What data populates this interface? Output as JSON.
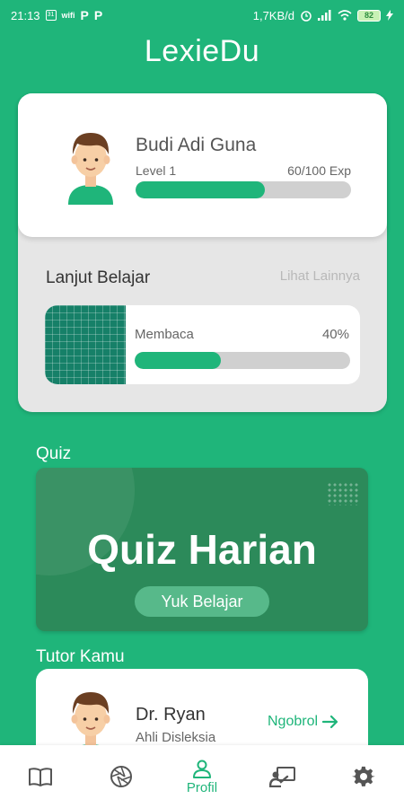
{
  "status_bar": {
    "time": "21:13",
    "calendar": "31",
    "notif_label": "wifi",
    "p1": "P",
    "p2": "P",
    "net_speed": "1,7KB/d",
    "battery": "82"
  },
  "app": {
    "title": "LexieDu"
  },
  "profile": {
    "name": "Budi Adi Guna",
    "level": "Level 1",
    "exp": "60/100 Exp",
    "exp_progress": 0.6
  },
  "continue_learning": {
    "title": "Lanjut Belajar",
    "see_more": "Lihat Lainnya",
    "course": {
      "name": "Membaca",
      "percent": "40%",
      "progress": 0.4
    }
  },
  "quiz": {
    "section_title": "Quiz",
    "card_title": "Quiz Harian",
    "button": "Yuk Belajar"
  },
  "tutor": {
    "section_title": "Tutor Kamu",
    "name": "Dr. Ryan",
    "role": "Ahli Disleksia",
    "chat": "Ngobrol"
  },
  "nav": {
    "active": "profile",
    "items": [
      {
        "id": "book",
        "icon": "book-icon"
      },
      {
        "id": "shutter",
        "icon": "camera-shutter-icon"
      },
      {
        "id": "profile",
        "icon": "person-icon",
        "label": "Profil"
      },
      {
        "id": "teacher",
        "icon": "teacher-board-icon"
      },
      {
        "id": "settings",
        "icon": "gear-icon"
      }
    ]
  },
  "colors": {
    "primary": "#1fb57a",
    "quiz_card": "#2c8a5a",
    "card_gray": "#e6e6e6",
    "course_thumb": "#168068",
    "progress_track": "#d0d0d0"
  }
}
